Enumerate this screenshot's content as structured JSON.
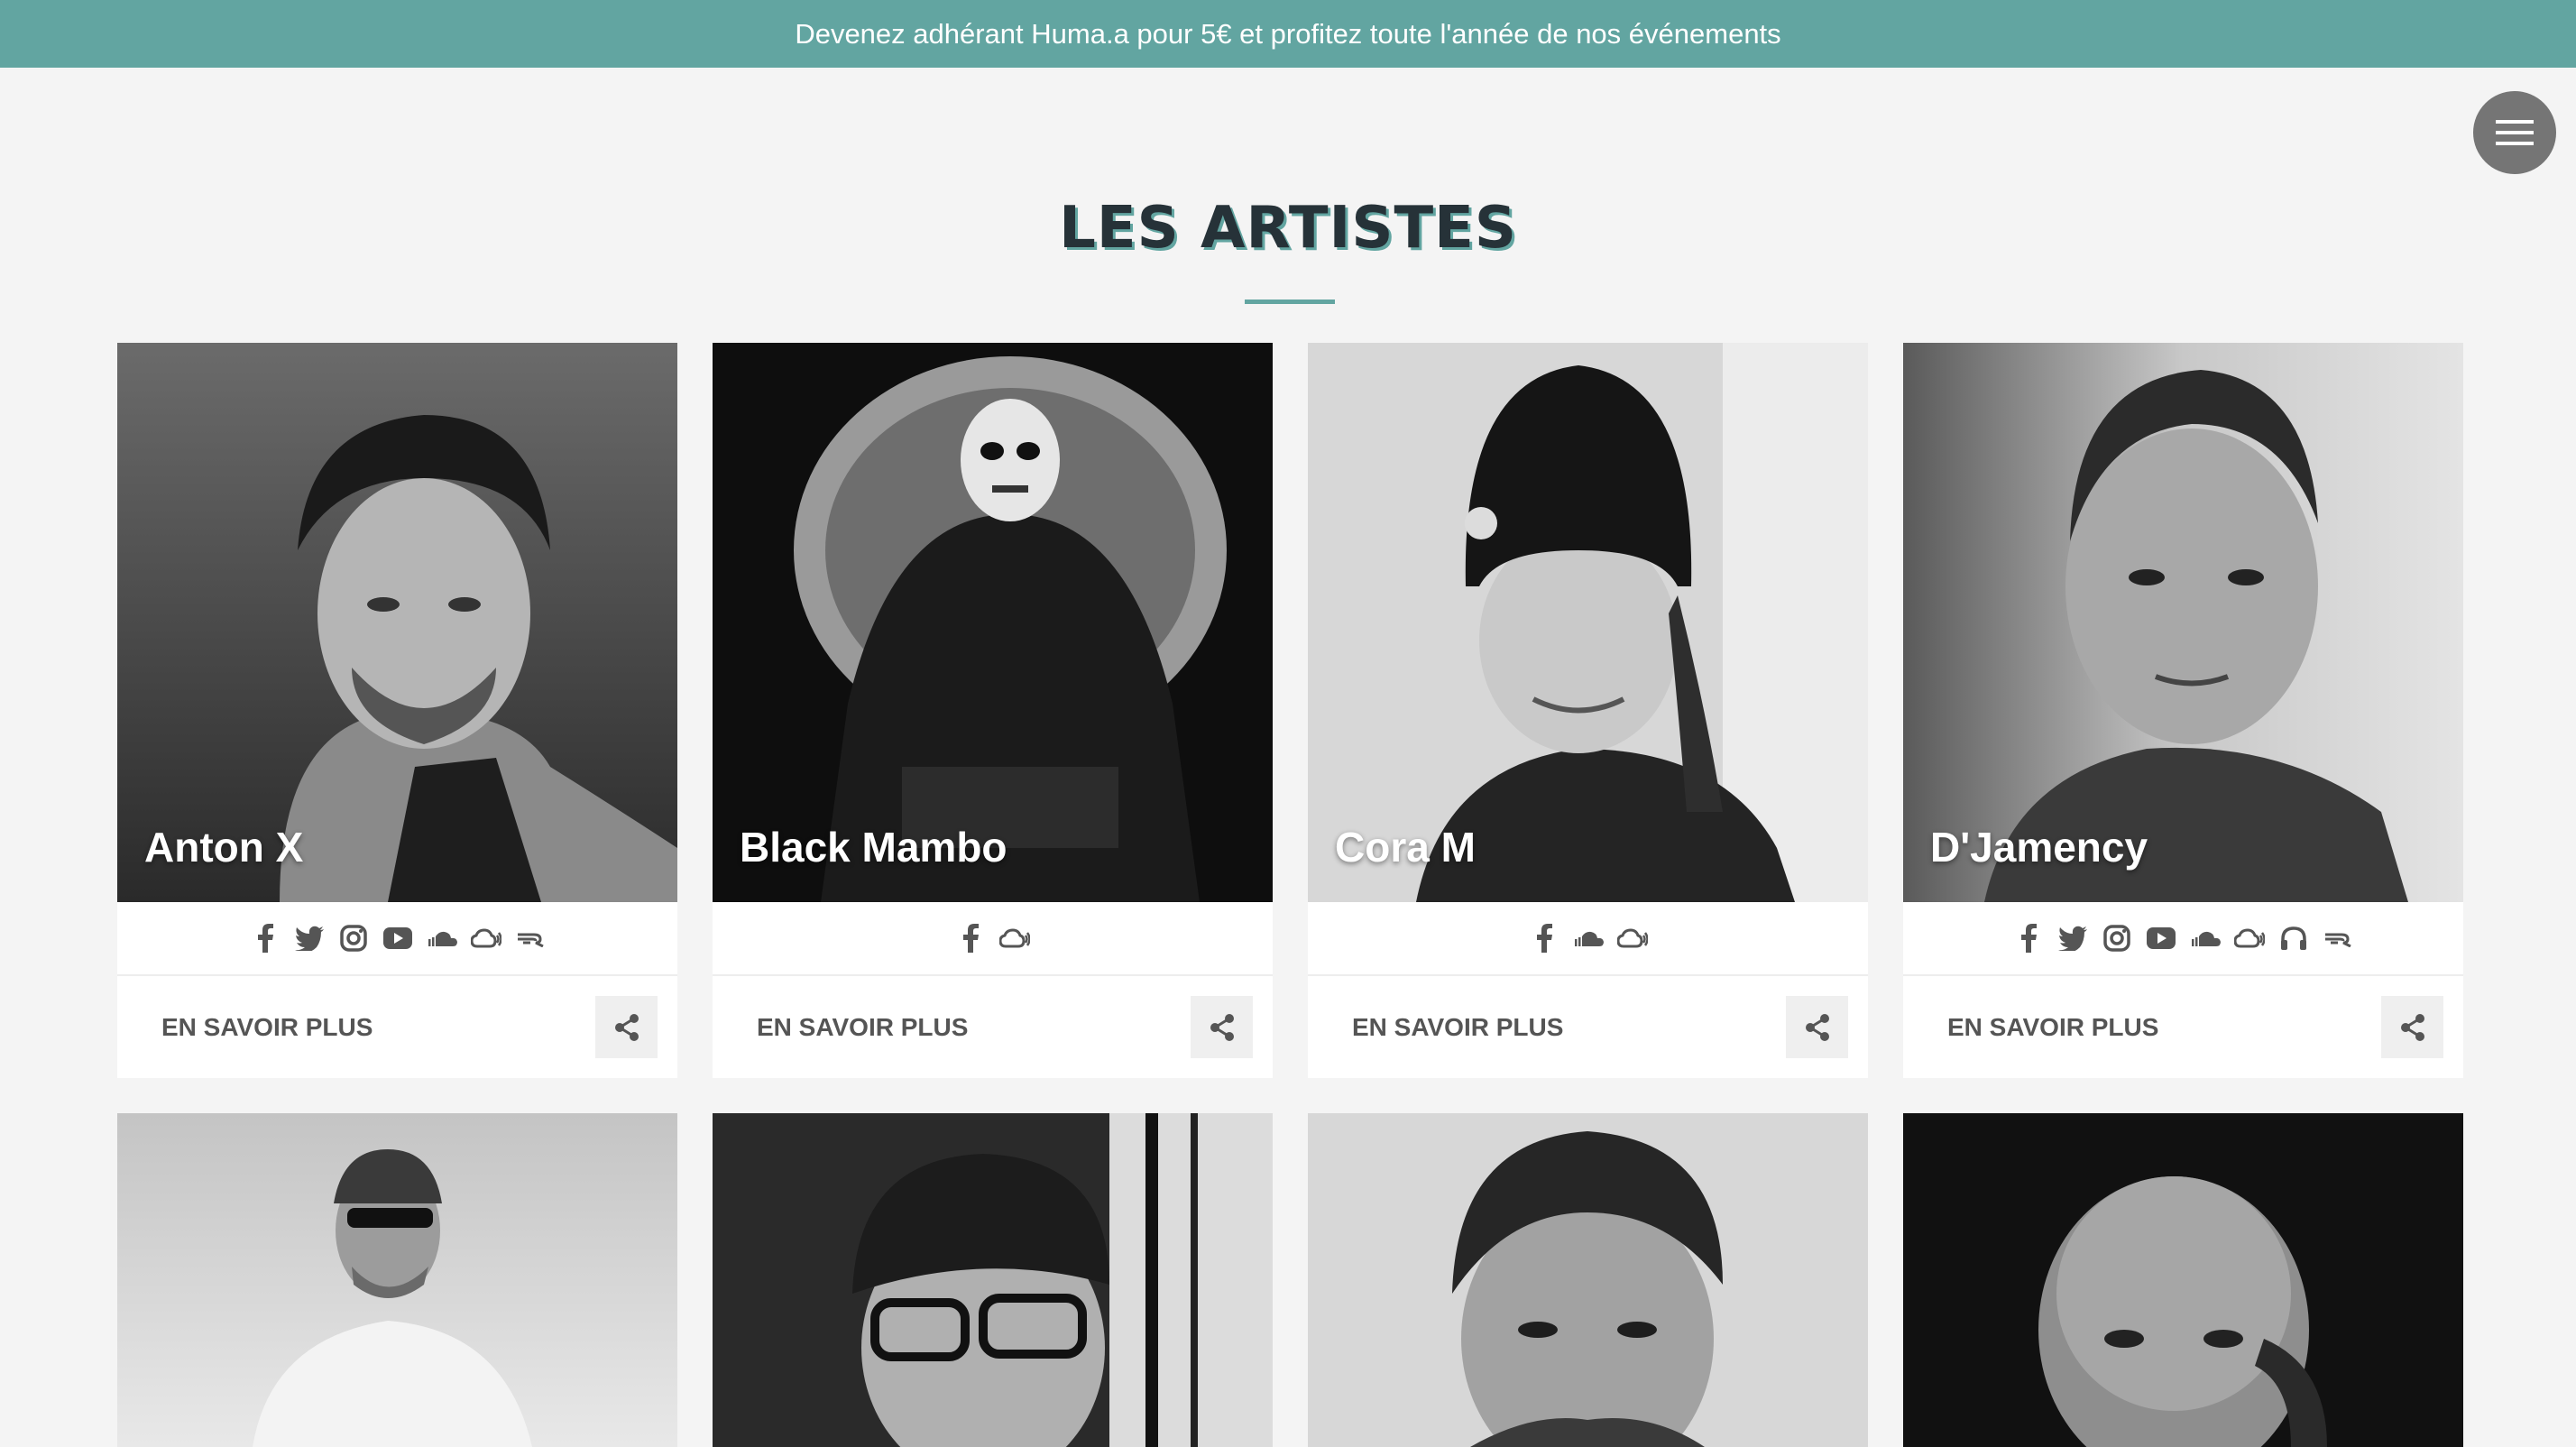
{
  "banner": {
    "text": "Devenez adhérant Huma.a pour 5€ et profitez toute l'année de nos événements"
  },
  "header": {
    "title": "LES ARTISTES",
    "menu_icon": "hamburger-menu-icon"
  },
  "colors": {
    "accent": "#62a5a1",
    "banner_bg": "#62a5a1",
    "title_text": "#263238",
    "icon": "#555555",
    "menu_bg": "#757575"
  },
  "artists": [
    {
      "name": "Anton X",
      "socials": [
        "facebook",
        "twitter",
        "instagram",
        "youtube",
        "soundcloud",
        "mixcloud",
        "residentadvisor"
      ],
      "more_label": "EN SAVOIR PLUS"
    },
    {
      "name": "Black Mambo",
      "socials": [
        "facebook",
        "mixcloud"
      ],
      "more_label": "EN SAVOIR PLUS"
    },
    {
      "name": "Cora M",
      "socials": [
        "facebook",
        "soundcloud",
        "mixcloud"
      ],
      "more_label": "EN SAVOIR PLUS"
    },
    {
      "name": "D'Jamency",
      "socials": [
        "facebook",
        "twitter",
        "instagram",
        "youtube",
        "soundcloud",
        "mixcloud",
        "headphones",
        "residentadvisor"
      ],
      "more_label": "EN SAVOIR PLUS"
    }
  ]
}
